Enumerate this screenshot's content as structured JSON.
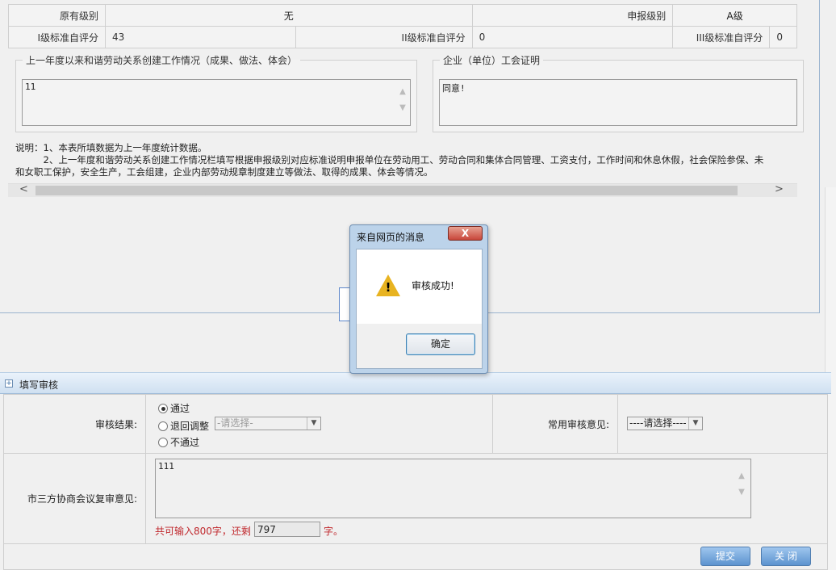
{
  "info": {
    "orig_level_label": "原有级别",
    "orig_level_value": "无",
    "apply_level_label": "申报级别",
    "apply_level_value": "A级",
    "l1_label": "I级标准自评分",
    "l1_value": "43",
    "l2_label": "II级标准自评分",
    "l2_value": "0",
    "l3_label": "III级标准自评分",
    "l3_value": "0"
  },
  "situation": {
    "legend": "上一年度以来和谐劳动关系创建工作情况（成果、做法、体会）",
    "value": "11"
  },
  "union": {
    "legend": "企业（单位）工会证明",
    "value": "同意!"
  },
  "note": {
    "line1": "说明：1、本表所填数据为上一年度统计数据。",
    "line2": "　　　2、上一年度和谐劳动关系创建工作情况栏填写根据申报级别对应标准说明申报单位在劳动用工、劳动合同和集体合同管理、工资支付，工作时间和休息休假，社会保险参保、未",
    "line3": "和女职工保护，安全生产，工会组建，企业内部劳动规章制度建立等做法、取得的成果、体会等情况。"
  },
  "dialog": {
    "title": "来自网页的消息",
    "close": "X",
    "message": "审核成功!",
    "ok": "确定"
  },
  "review": {
    "section_title": "填写审核",
    "result_label": "审核结果:",
    "options": [
      "通过",
      "退回调整",
      "不通过"
    ],
    "return_select_placeholder": "-请选择-",
    "common_label": "常用审核意见:",
    "common_select": "----请选择----",
    "opinion_label": "市三方协商会议复审意见:",
    "opinion_value": "111",
    "limit_text_pre": "共可输入800字，还剩",
    "remaining": "797",
    "limit_text_post": "字。"
  },
  "buttons": {
    "submit": "提交",
    "close": "关 闭"
  }
}
